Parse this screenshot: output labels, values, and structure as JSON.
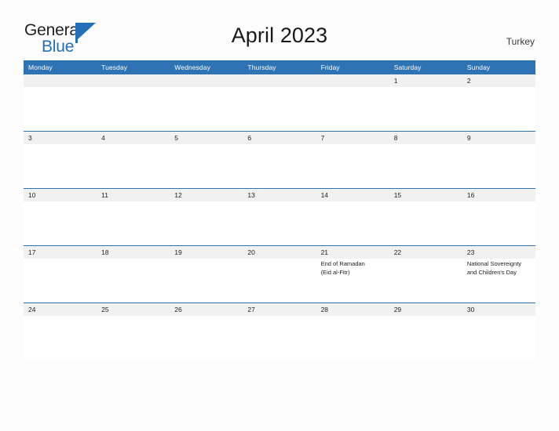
{
  "brand": {
    "name_primary": "General",
    "name_secondary": "Blue",
    "flag_icon": "blue-flag-icon",
    "primary_color": "#231f20",
    "secondary_color": "#2170b8"
  },
  "header": {
    "title": "April 2023",
    "country": "Turkey"
  },
  "calendar": {
    "header_color": "#2e74b5",
    "daynum_band_color": "#f1f1f1",
    "weekday_headers": [
      "Monday",
      "Tuesday",
      "Wednesday",
      "Thursday",
      "Friday",
      "Saturday",
      "Sunday"
    ],
    "weeks": [
      {
        "days": [
          {
            "num": "",
            "events": []
          },
          {
            "num": "",
            "events": []
          },
          {
            "num": "",
            "events": []
          },
          {
            "num": "",
            "events": []
          },
          {
            "num": "",
            "events": []
          },
          {
            "num": "1",
            "events": []
          },
          {
            "num": "2",
            "events": []
          }
        ]
      },
      {
        "days": [
          {
            "num": "3",
            "events": []
          },
          {
            "num": "4",
            "events": []
          },
          {
            "num": "5",
            "events": []
          },
          {
            "num": "6",
            "events": []
          },
          {
            "num": "7",
            "events": []
          },
          {
            "num": "8",
            "events": []
          },
          {
            "num": "9",
            "events": []
          }
        ]
      },
      {
        "days": [
          {
            "num": "10",
            "events": []
          },
          {
            "num": "11",
            "events": []
          },
          {
            "num": "12",
            "events": []
          },
          {
            "num": "13",
            "events": []
          },
          {
            "num": "14",
            "events": []
          },
          {
            "num": "15",
            "events": []
          },
          {
            "num": "16",
            "events": []
          }
        ]
      },
      {
        "days": [
          {
            "num": "17",
            "events": []
          },
          {
            "num": "18",
            "events": []
          },
          {
            "num": "19",
            "events": []
          },
          {
            "num": "20",
            "events": []
          },
          {
            "num": "21",
            "events": [
              "End of Ramadan",
              "(Eid al-Fitr)"
            ]
          },
          {
            "num": "22",
            "events": []
          },
          {
            "num": "23",
            "events": [
              "National Sovereignty and Children's Day"
            ]
          }
        ]
      },
      {
        "days": [
          {
            "num": "24",
            "events": []
          },
          {
            "num": "25",
            "events": []
          },
          {
            "num": "26",
            "events": []
          },
          {
            "num": "27",
            "events": []
          },
          {
            "num": "28",
            "events": []
          },
          {
            "num": "29",
            "events": []
          },
          {
            "num": "30",
            "events": []
          }
        ]
      }
    ]
  }
}
